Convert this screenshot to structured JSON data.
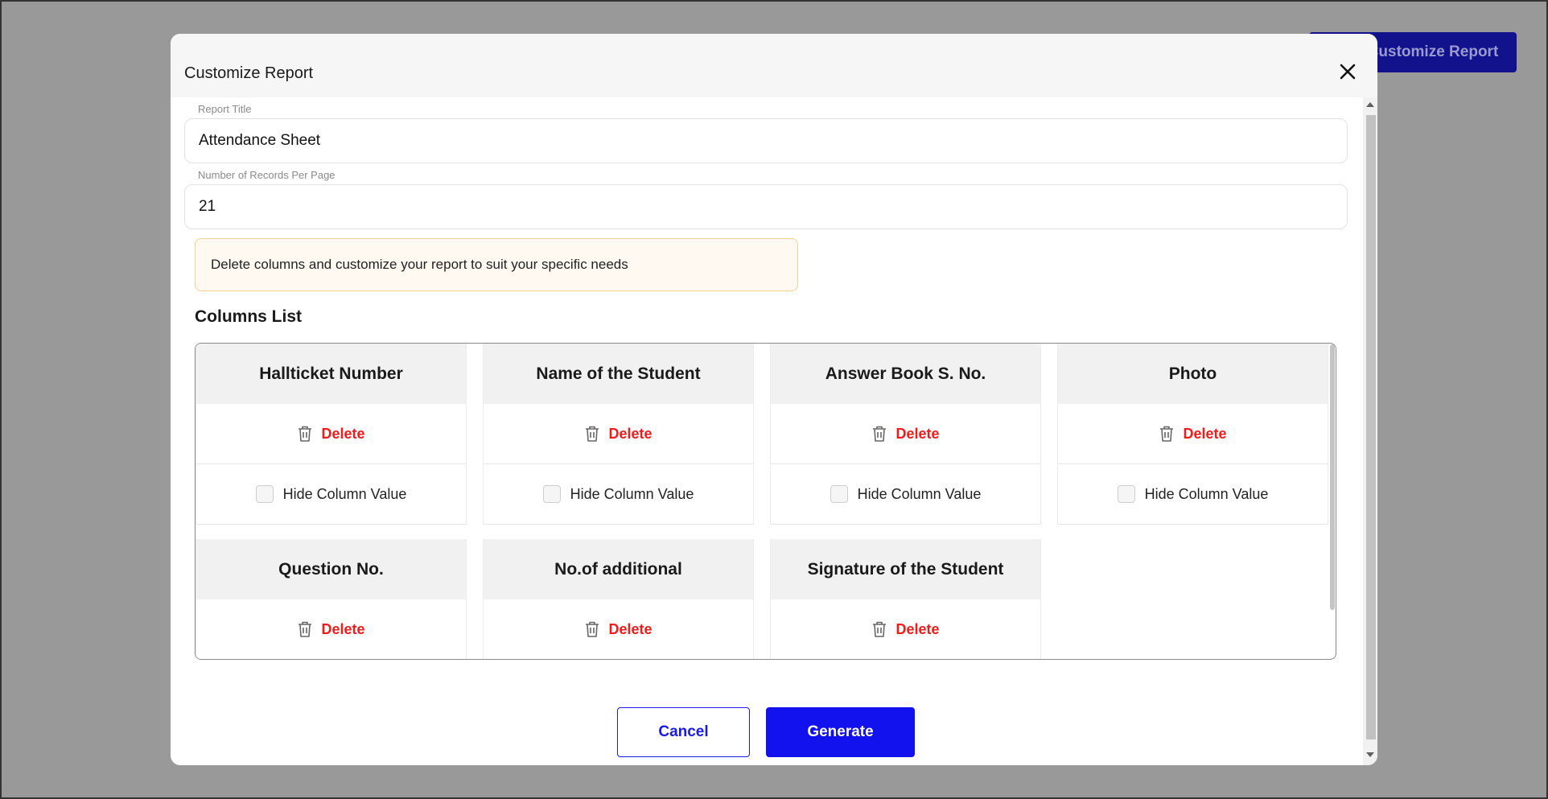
{
  "background_button": {
    "label": "Customize Report"
  },
  "modal": {
    "title": "Customize Report",
    "fields": {
      "report_title": {
        "label": "Report Title",
        "value": "Attendance Sheet"
      },
      "records_per_page": {
        "label": "Number of Records Per Page",
        "value": "21"
      }
    },
    "info_message": "Delete columns and customize your report to suit your specific needs",
    "columns_heading": "Columns List",
    "columns": [
      {
        "name": "Hallticket Number",
        "delete_label": "Delete",
        "hide_label": "Hide Column Value",
        "hidden": false
      },
      {
        "name": "Name of the Student",
        "delete_label": "Delete",
        "hide_label": "Hide Column Value",
        "hidden": false
      },
      {
        "name": "Answer Book S. No.",
        "delete_label": "Delete",
        "hide_label": "Hide Column Value",
        "hidden": false
      },
      {
        "name": "Photo",
        "delete_label": "Delete",
        "hide_label": "Hide Column Value",
        "hidden": false
      },
      {
        "name": "Question No.",
        "delete_label": "Delete"
      },
      {
        "name": "No.of additional",
        "delete_label": "Delete"
      },
      {
        "name": "Signature of the Student",
        "delete_label": "Delete"
      }
    ],
    "buttons": {
      "cancel": "Cancel",
      "generate": "Generate"
    }
  },
  "colors": {
    "primary": "#1212ee",
    "danger": "#ef1c1c",
    "info_bg": "#fff9f2",
    "info_border": "#f5d28b",
    "overlay": "#999999"
  }
}
